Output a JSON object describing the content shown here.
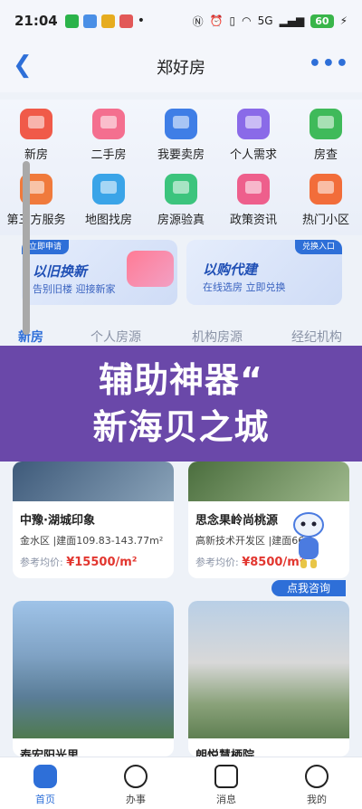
{
  "status_bar": {
    "time": "21:04",
    "battery": "60",
    "network": "5G",
    "left_icons": [
      "wechat-icon",
      "email-icon",
      "weibo-icon",
      "app-icon"
    ],
    "right_icons": [
      "nfc-icon",
      "alarm-icon",
      "vibrate-icon",
      "wifi-icon",
      "signal-icon",
      "charging-icon"
    ]
  },
  "nav": {
    "title": "郑好房",
    "more": "•••"
  },
  "grid": {
    "items": [
      {
        "label": "新房",
        "icon": "new-house-icon",
        "color": "#f05a49"
      },
      {
        "label": "二手房",
        "icon": "second-hand-house-icon",
        "color": "#f46f8f"
      },
      {
        "label": "我要卖房",
        "icon": "sell-house-icon",
        "color": "#3f7ee6"
      },
      {
        "label": "个人需求",
        "icon": "personal-demand-icon",
        "color": "#8a6ae8"
      },
      {
        "label": "房查",
        "icon": "house-check-icon",
        "color": "#3fba5a"
      },
      {
        "label": "第三方服务",
        "icon": "third-party-service-icon",
        "color": "#f07a3c"
      },
      {
        "label": "地图找房",
        "icon": "map-search-icon",
        "color": "#3aa4e8"
      },
      {
        "label": "房源验真",
        "icon": "listing-verify-icon",
        "color": "#3cc47d"
      },
      {
        "label": "政策资讯",
        "icon": "policy-news-icon",
        "color": "#ee5f8c"
      },
      {
        "label": "热门小区",
        "icon": "hot-community-icon",
        "color": "#f26d3a"
      }
    ]
  },
  "promos": [
    {
      "tag": "立即申请",
      "title": "以旧换新",
      "subtitle": "告别旧楼 迎接新家"
    },
    {
      "tag": "兑换入口",
      "title": "以购代建",
      "subtitle": "在线选房 立即兑换"
    }
  ],
  "tabs": [
    "新房",
    "个人房源",
    "机构房源",
    "经纪机构"
  ],
  "overlay": {
    "line1": "辅助神器“",
    "line2": "新海贝之城"
  },
  "listings": [
    {
      "name": "中豫·湖城印象",
      "info": "金水区 |建面109.83-143.77m²",
      "price_label": "参考均价:",
      "price": "¥15500/m²"
    },
    {
      "name": "思念果岭尚桃源",
      "info": "高新技术开发区 |建面66-1",
      "price_label": "参考均价:",
      "price": "¥8500/m²"
    },
    {
      "name": "泰宏阳光里"
    },
    {
      "name": "朗悦慧栖院"
    }
  ],
  "consult_button": "点我咨询",
  "bottom_nav": [
    {
      "label": "首页",
      "icon": "home-icon"
    },
    {
      "label": "办事",
      "icon": "service-icon"
    },
    {
      "label": "消息",
      "icon": "message-icon"
    },
    {
      "label": "我的",
      "icon": "profile-icon"
    }
  ]
}
